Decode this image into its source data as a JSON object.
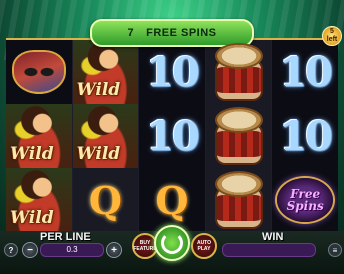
{
  "banner": {
    "count": "7",
    "label": "FREE SPINS"
  },
  "badge": {
    "number": "5",
    "text": "left"
  },
  "symbols": {
    "wild_text": "Wild",
    "ten_text": "10",
    "q_text": "Q",
    "free_spins_line1": "Free",
    "free_spins_line2": "Spins"
  },
  "reels": [
    [
      "mask",
      "wild",
      "wild"
    ],
    [
      "wild",
      "wild",
      "q"
    ],
    [
      "ten",
      "ten",
      "q"
    ],
    [
      "drum",
      "drum",
      "drum"
    ],
    [
      "ten",
      "ten",
      "free_spins"
    ]
  ],
  "bottom": {
    "per_line_label": "PER LINE",
    "bet_value": "0.3",
    "minus": "−",
    "plus": "+",
    "max_label": "BUY",
    "max_sub": "FEATURE",
    "auto_label": "AUTO",
    "auto_sub": "PLAY",
    "win_label": "WIN",
    "win_value": "",
    "help": "?"
  },
  "colors": {
    "accent": "#2e9a2a",
    "field": "#3a1a55",
    "frame_gold": "#d9b44a"
  }
}
